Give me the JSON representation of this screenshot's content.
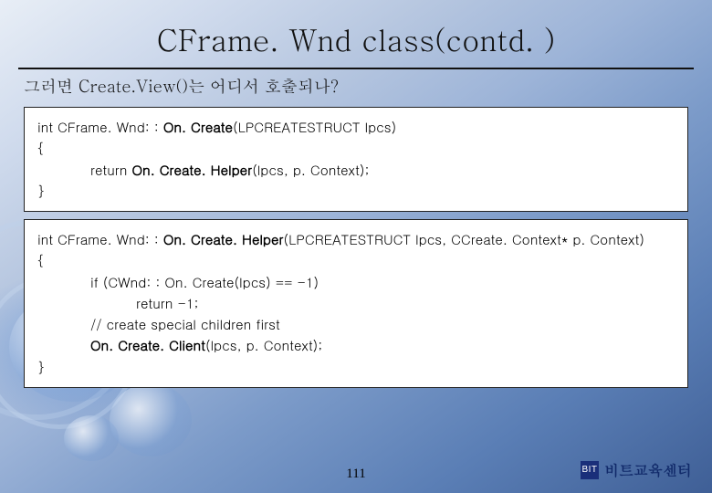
{
  "title": "CFrame. Wnd class(contd. )",
  "subtitle": "그러면 Create.View()는 어디서 호출되나?",
  "box1": {
    "sig_prefix": "int CFrame. Wnd: : ",
    "sig_bold": "On. Create",
    "sig_suffix": "(LPCREATESTRUCT lpcs)",
    "brace_open": "{",
    "ret_prefix": "return ",
    "ret_bold": "On. Create. Helper",
    "ret_suffix": "(lpcs, p. Context);",
    "brace_close": "}"
  },
  "box2": {
    "sig_prefix": "int CFrame. Wnd: : ",
    "sig_bold": "On. Create. Helper",
    "sig_suffix": "(LPCREATESTRUCT lpcs, CCreate. Context* p. Context)",
    "brace_open": "{",
    "if_line": "if (CWnd: : On. Create(lpcs) == -1)",
    "return_line": "return -1;",
    "comment": "// create special children first",
    "call_bold": "On. Create. Client",
    "call_suffix": "(lpcs, p. Context);",
    "brace_close": "}"
  },
  "page_number": "111",
  "brand_badge": "BIT",
  "brand_text": "비트교육센터"
}
